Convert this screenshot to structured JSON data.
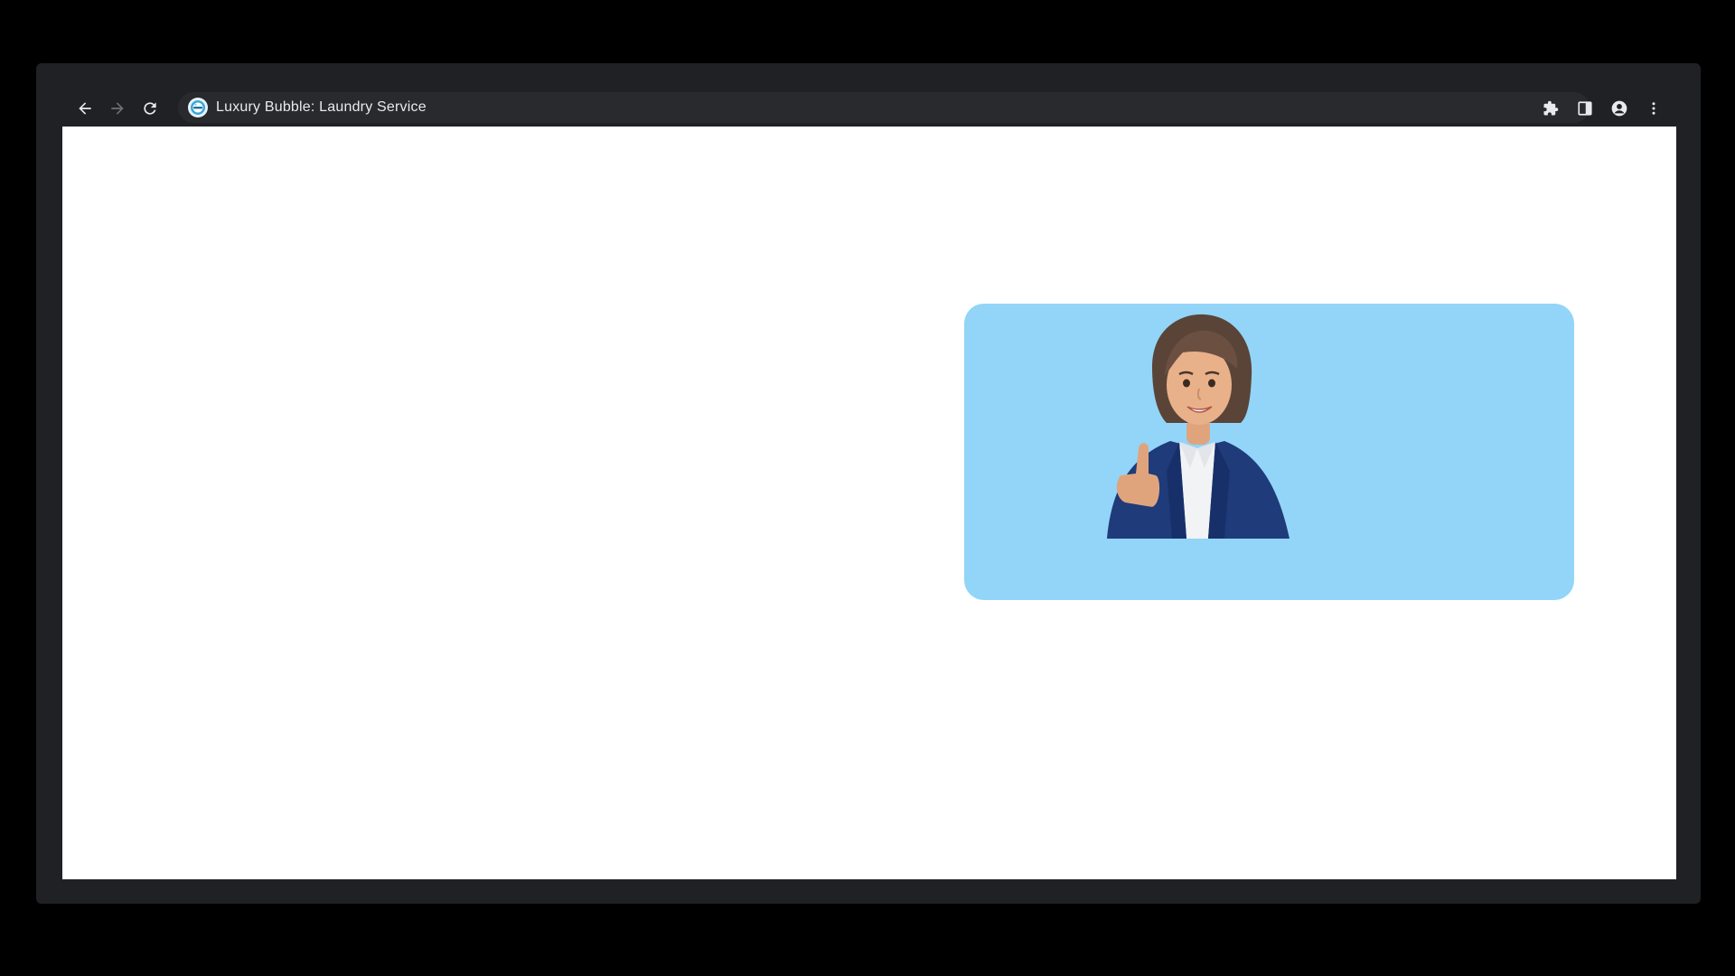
{
  "browser": {
    "tab_title": "Luxury Bubble: Laundry Service",
    "site_icon": "bubble-logo-icon",
    "nav_icons": [
      "back-arrow-icon",
      "forward-arrow-icon",
      "reload-icon"
    ],
    "toolbar_icons": [
      "extensions-puzzle-icon",
      "side-panel-icon",
      "profile-icon",
      "kebab-menu-icon"
    ]
  },
  "page": {
    "background_color": "#ffffff",
    "hero_card": {
      "background_color": "#92d5f8",
      "illustration": "businesswoman-thumbs-up-avatar"
    }
  },
  "colors": {
    "chrome_bg": "#202124",
    "omnibox_bg": "#282a2d",
    "chrome_text": "#e8eaed",
    "disabled_icon": "#6f7175"
  }
}
